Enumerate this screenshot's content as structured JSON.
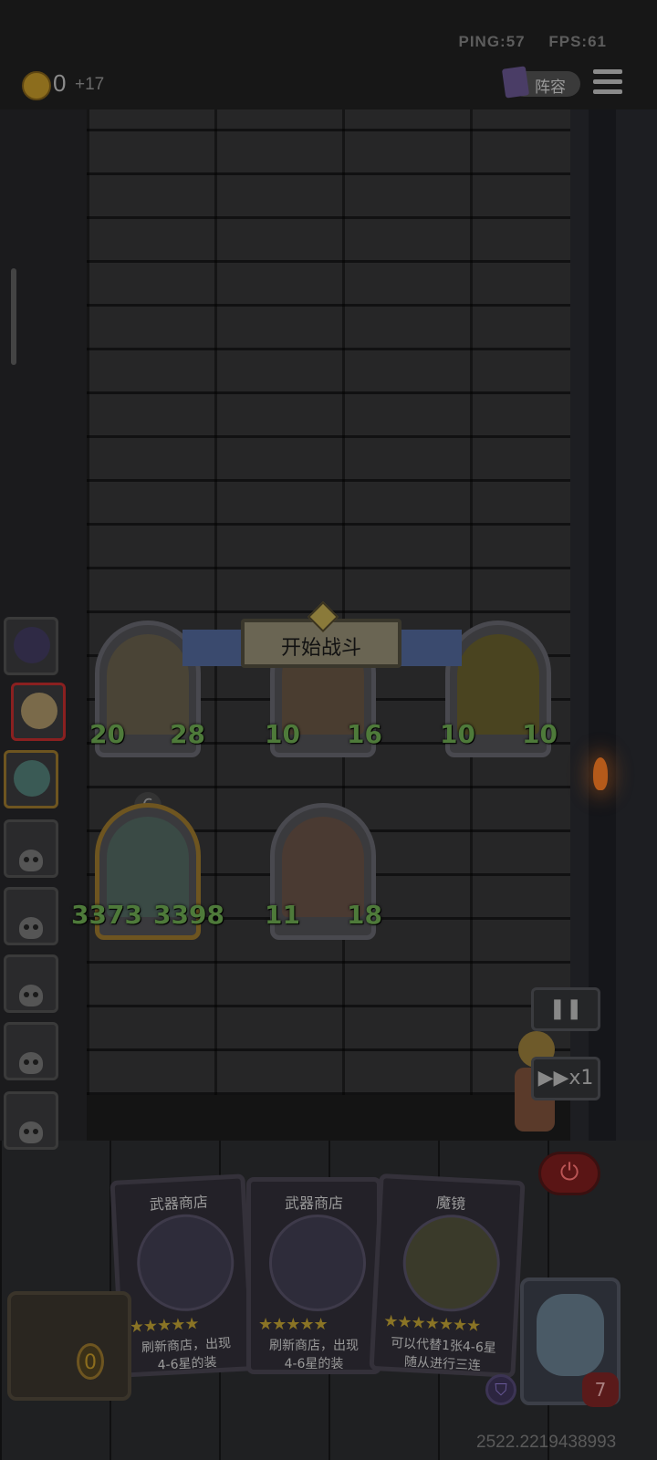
{
  "status": {
    "ping": "PING:57",
    "fps": "FPS:61"
  },
  "currency": {
    "value": "0",
    "increment": "+17"
  },
  "header": {
    "lineup_label": "阵容"
  },
  "banner": {
    "start_battle": "开始战斗"
  },
  "enemy_units": [
    {
      "attack": "20",
      "health": "28"
    },
    {
      "attack": "10",
      "health": "16"
    },
    {
      "attack": "10",
      "health": "10"
    }
  ],
  "player_units": [
    {
      "level": "6",
      "attack": "3373",
      "health": "3398"
    },
    {
      "attack": "11",
      "health": "18"
    }
  ],
  "controls": {
    "pause_icon": "pause-icon",
    "speed_label": "▶▶x1",
    "power_icon": "power-icon"
  },
  "shop_cards": [
    {
      "title": "武器商店",
      "stars": "★★★★★",
      "desc_line1": "刷新商店，出现",
      "desc_line2": "4-6星的装"
    },
    {
      "title": "武器商店",
      "stars": "★★★★★",
      "desc_line1": "刷新商店，出现",
      "desc_line2": "4-6星的装"
    },
    {
      "title": "魔镜",
      "stars": "★★★★★★★",
      "desc_line1": "可以代替1张4-6星",
      "desc_line2": "随从进行三连"
    }
  ],
  "chest": {
    "count": "0"
  },
  "hero": {
    "armor": "",
    "health": "7"
  },
  "footer": {
    "uid": "2522.2219438993"
  }
}
